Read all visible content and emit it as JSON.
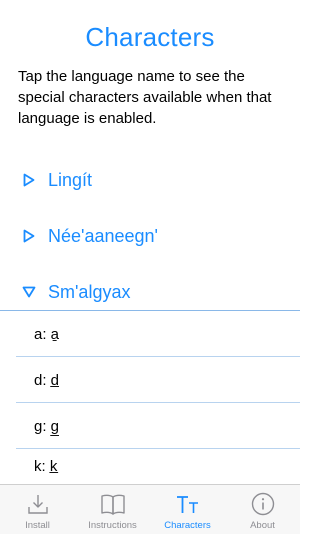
{
  "header": {
    "title": "Characters",
    "intro": "Tap the language name to see the special characters available when that language is enabled."
  },
  "languages": [
    {
      "label": "Lingít",
      "expanded": false
    },
    {
      "label": "Née'aaneegn'",
      "expanded": false
    },
    {
      "label": "Sm'algyax",
      "expanded": true
    }
  ],
  "characters": [
    {
      "text": "a: a̱"
    },
    {
      "text": "d: d̲"
    },
    {
      "text": "g: g̲"
    },
    {
      "text": "k: k̲"
    }
  ],
  "tabs": [
    {
      "label": "Install",
      "icon": "download-icon",
      "active": false
    },
    {
      "label": "Instructions",
      "icon": "book-icon",
      "active": false
    },
    {
      "label": "Characters",
      "icon": "text-size-icon",
      "active": true
    },
    {
      "label": "About",
      "icon": "info-icon",
      "active": false
    }
  ],
  "colors": {
    "accent": "#1a8cff",
    "inactive": "#8e8e93"
  }
}
